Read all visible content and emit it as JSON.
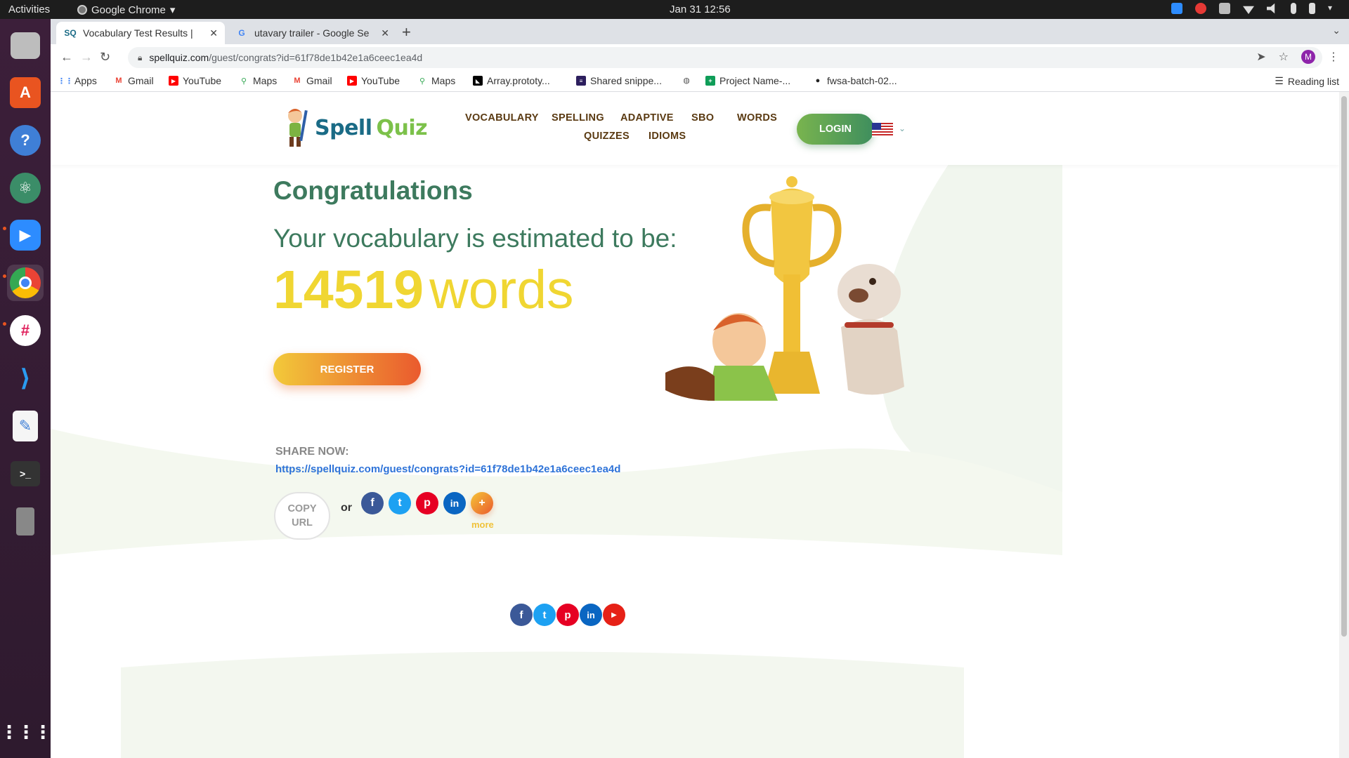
{
  "system": {
    "activities": "Activities",
    "app_name": "Google Chrome",
    "clock": "Jan 31  12:56"
  },
  "dock": {
    "items": [
      "files-icon",
      "ubuntu-software-icon",
      "help-icon",
      "atom-icon",
      "zoom-icon",
      "chrome-icon",
      "slack-icon",
      "vscode-icon",
      "text-editor-icon",
      "terminal-icon",
      "usb-drive-icon",
      "show-apps-icon"
    ]
  },
  "browser": {
    "tabs": [
      {
        "title": "Vocabulary Test Results |",
        "active": true
      },
      {
        "title": "utavary trailer - Google Se",
        "active": false
      }
    ],
    "url_host": "spellquiz.com",
    "url_path": "/guest/congrats?id=61f78de1b42e1a6ceec1ea4d",
    "avatar_letter": "M",
    "bookmarks": [
      "Apps",
      "Gmail",
      "YouTube",
      "Maps",
      "Gmail",
      "YouTube",
      "Maps",
      "Array.prototy...",
      "Shared snippe...",
      "",
      "Project Name-...",
      "fwsa-batch-02..."
    ],
    "reading_list": "Reading list"
  },
  "site": {
    "logo_word1": "Spell",
    "logo_word2": "Quiz",
    "nav": [
      "VOCABULARY",
      "SPELLING",
      "ADAPTIVE",
      "SBO",
      "WORDS",
      "QUIZZES",
      "IDIOMS"
    ],
    "login": "LOGIN",
    "congrats": "Congratulations",
    "estimate": "Your vocabulary is estimated to be:",
    "word_count": "14519",
    "word_unit": "words",
    "register": "REGISTER",
    "share_label": "SHARE NOW:",
    "share_url": "https://spellquiz.com/guest/congrats?id=61f78de1b42e1a6ceec1ea4d",
    "copy_url_line1": "COPY",
    "copy_url_line2": "URL",
    "or": "or",
    "social": [
      "f",
      "t",
      "p",
      "in",
      "+"
    ],
    "more": "more"
  },
  "colors": {
    "accent_green": "#3d7a5e",
    "accent_yellow": "#f0d632",
    "link_blue": "#2e73d8",
    "nav_brown": "#5a3a12"
  }
}
